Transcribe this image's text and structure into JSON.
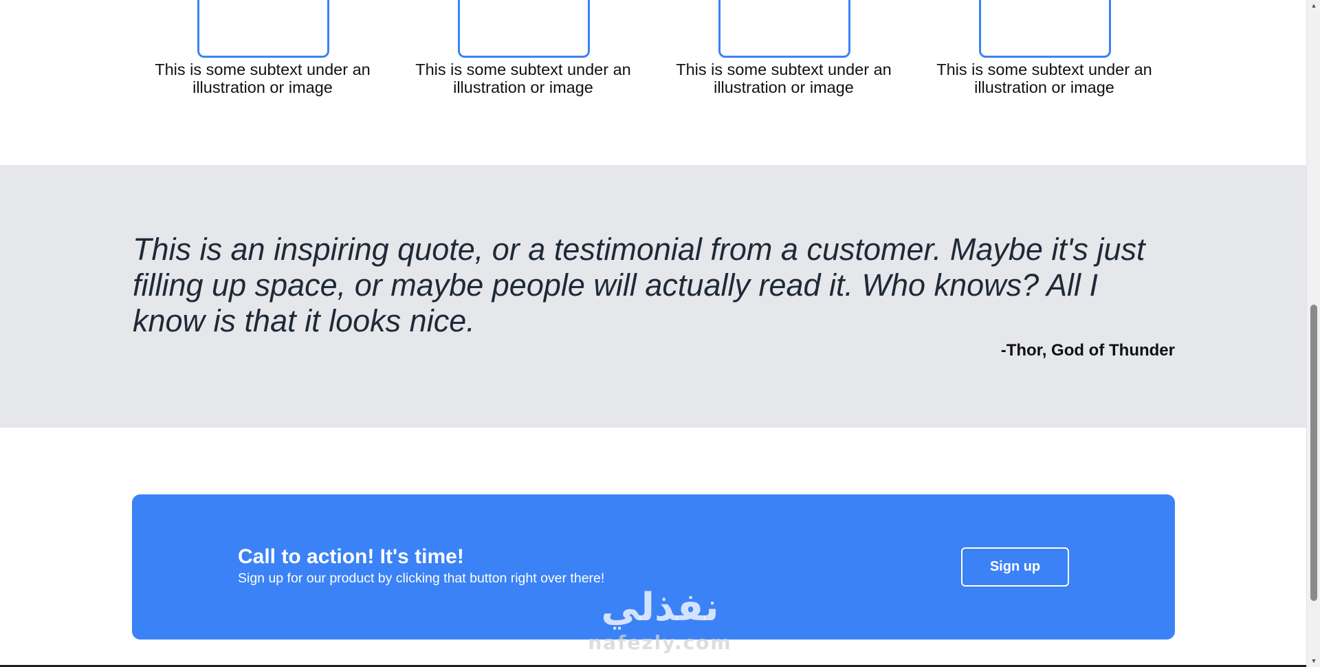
{
  "info_cards": [
    {
      "text": "This is some subtext under an illustration or image"
    },
    {
      "text": "This is some subtext under an illustration or image"
    },
    {
      "text": "This is some subtext under an illustration or image"
    },
    {
      "text": "This is some subtext under an illustration or image"
    }
  ],
  "quote": {
    "text": "This is an inspiring quote, or a testimonial from a customer. Maybe it's just filling up space, or maybe people will actually read it. Who knows? All I know is that it looks nice.",
    "author": "-Thor, God of Thunder"
  },
  "cta": {
    "title": "Call to action! It's time!",
    "subtitle": "Sign up for our product by clicking that button right over there!",
    "button_label": "Sign up"
  },
  "watermark": {
    "main": "نفذلي",
    "sub": "nafezly.com"
  },
  "scrollbar": {
    "up_icon": "▲",
    "down_icon": "▼"
  },
  "colors": {
    "accent": "#3b82f6",
    "quote_bg": "#e5e7eb",
    "quote_text": "#1f2937"
  }
}
